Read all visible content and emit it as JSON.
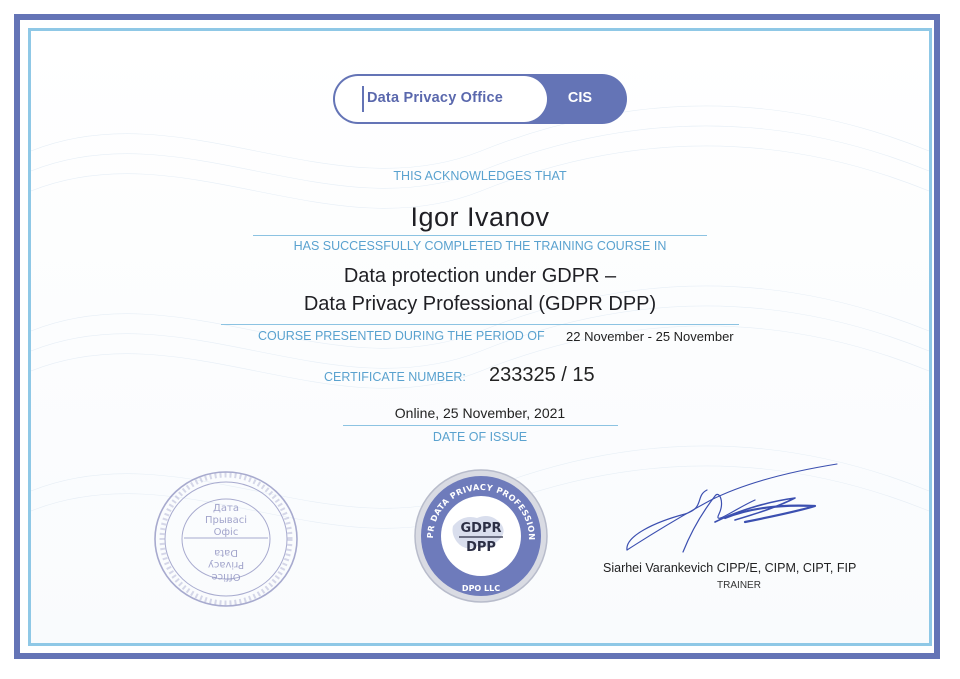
{
  "logo": {
    "name": "Data Privacy Office",
    "region": "CIS"
  },
  "certificate": {
    "acknowledges_label": "THIS ACKNOWLEDGES THAT",
    "recipient_name": "Igor Ivanov",
    "completed_label": "HAS SUCCESSFULLY COMPLETED THE TRAINING COURSE IN",
    "course_line1": "Data protection under GDPR –",
    "course_line2": "Data Privacy Professional (GDPR DPP)",
    "period_label": "COURSE PRESENTED DURING THE PERIOD OF",
    "period_value": "22 November - 25 November",
    "number_label": "CERTIFICATE NUMBER:",
    "number_value": "233325 / 15",
    "issue_value": "Online, 25 November, 2021",
    "issue_label": "DATE OF ISSUE"
  },
  "badge": {
    "ring_text": "GDPR DATA PRIVACY PROFESSIONAL",
    "line1": "GDPR",
    "line2": "DPP",
    "bottom_text": "DPO LLC"
  },
  "seal": {
    "center_lines": [
      "Дата",
      "Прывасі",
      "Офіс",
      "Office",
      "Privacy",
      "Data"
    ]
  },
  "trainer": {
    "name": "Siarhei Varankevich CIPP/E, CIPM, CIPT, FIP",
    "role": "TRAINER"
  },
  "colors": {
    "primary": "#6474b6",
    "accent": "#5aa2cf",
    "frame_inner": "#8fc8e6"
  }
}
